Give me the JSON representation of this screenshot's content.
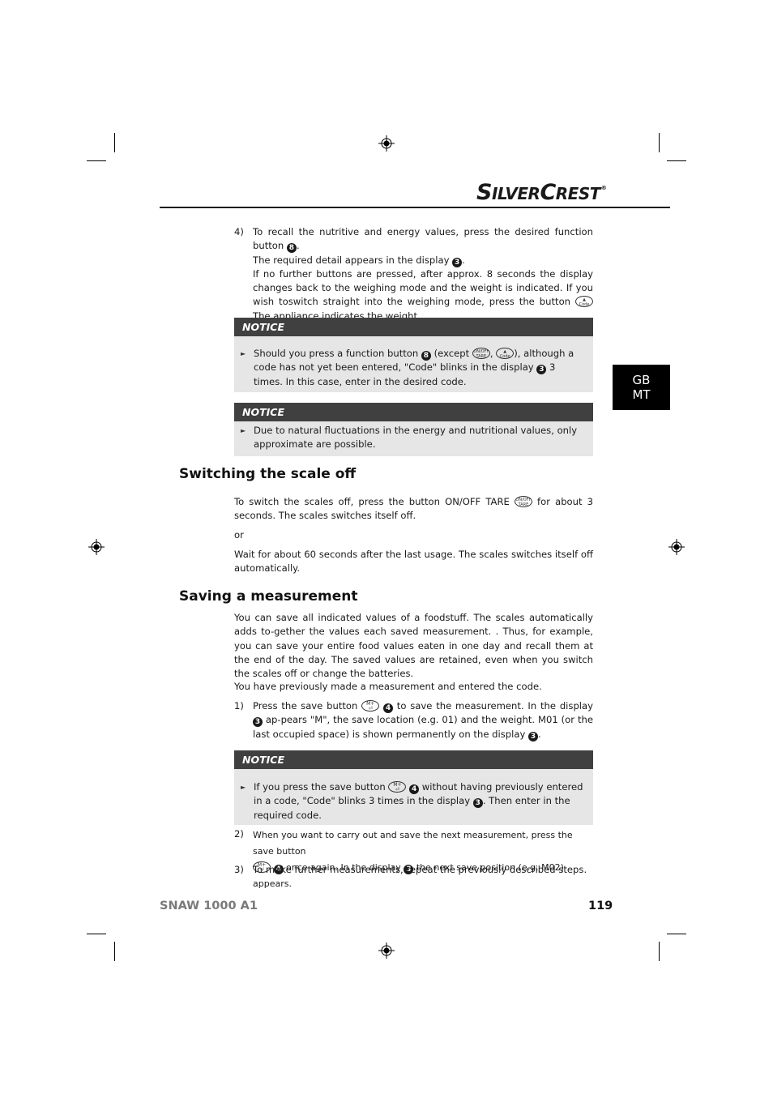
{
  "brand": {
    "name_part1_cap": "S",
    "name_part1_rest": "ILVER",
    "name_part2_cap": "C",
    "name_part2_rest": "REST",
    "registered": "®"
  },
  "language_tab": {
    "line1": "GB",
    "line2": "MT"
  },
  "step4": {
    "number": "4)",
    "line1": "To recall the nutritive and energy values, press the desired function button",
    "ref_function_button": "8",
    "line2": "The required detail appears in the display",
    "ref_display": "3",
    "line3": "If no further buttons are pressed, after approx. 8 seconds the display changes back to the weighing mode and the weight is indicated. If you wish toswitch straight into the weighing mode, press the button",
    "line3_icon": "code-button-icon",
    "line3_end": "The appliance indicates the weight."
  },
  "notice1": {
    "title": "NOTICE",
    "text_a": "Should you press a function button",
    "ref_a": "8",
    "text_b": "(except",
    "icon1": "on-off-tare-button-icon",
    "icon2": "code-button-icon",
    "text_c": "), although a code has not yet been entered, \"Code\" blinks in the display",
    "ref_c": "3",
    "text_d": "3 times. In this case, enter in the desired code."
  },
  "notice2": {
    "title": "NOTICE",
    "text": "Due to natural fluctuations in the energy and nutritional values, only approximate are possible."
  },
  "section_off": {
    "heading": "Switching the scale off",
    "para1_a": "To switch the scales off, press the button ON/OFF TARE",
    "para1_icon": "on-off-tare-button-icon",
    "para1_b": "for about 3 seconds. The scales switches itself off.",
    "or": "or",
    "para2": "Wait for about 60 seconds after the last usage. The scales switches itself off automatically."
  },
  "section_save": {
    "heading": "Saving a measurement",
    "intro": "You can save all indicated values of a foodstuff. The scales automatically adds to-gether the values each saved measurement. . Thus, for example, you can save your entire food values eaten in one day and recall them at the end of the day. The saved values are retained, even when you switch the scales off or change the batteries.",
    "precondition": "You have previously made a measurement and entered the code.",
    "step1": {
      "number": "1)",
      "text_a": "Press the save button",
      "icon": "m-plus-save-button-icon",
      "ref_a": "4",
      "text_b": "to save the measurement. In the display",
      "ref_b": "3",
      "text_c": "ap-pears \"M\", the save location (e.g. 01) and the weight. M01 (or the last occupied space) is shown permanently on the display",
      "ref_c": "3"
    },
    "notice": {
      "title": "NOTICE",
      "text_a": "If you press the save button",
      "icon": "m-plus-save-button-icon",
      "ref_a": "4",
      "text_b": "without having previously entered in a code, \"Code\" blinks 3 times in the display",
      "ref_b": "3",
      "text_c": ". Then enter in the required code."
    },
    "step2": {
      "number": "2)",
      "text_a": "When you want to carry out and save the next measurement, press the save button",
      "icon": "m-plus-save-button-icon",
      "ref_a": "4",
      "text_b": "once again. In the display",
      "ref_b": "3",
      "text_c": "the next save position (e.g. M02) appears."
    },
    "step3": {
      "number": "3)",
      "text": "To make further measurements, repeat the previously described steps."
    }
  },
  "icon_labels": {
    "on_off_top": "ON/OFF",
    "on_off_bottom": "TARE",
    "code": "Code",
    "m_plus": "M+",
    "enter": "⏎"
  },
  "footer": {
    "model": "SNAW 1000 A1",
    "page": "119"
  },
  "colors": {
    "notice_header": "#404040",
    "notice_body": "#e6e6e6",
    "footer_model": "#7a7a7a",
    "lang_tab": "#000000"
  }
}
